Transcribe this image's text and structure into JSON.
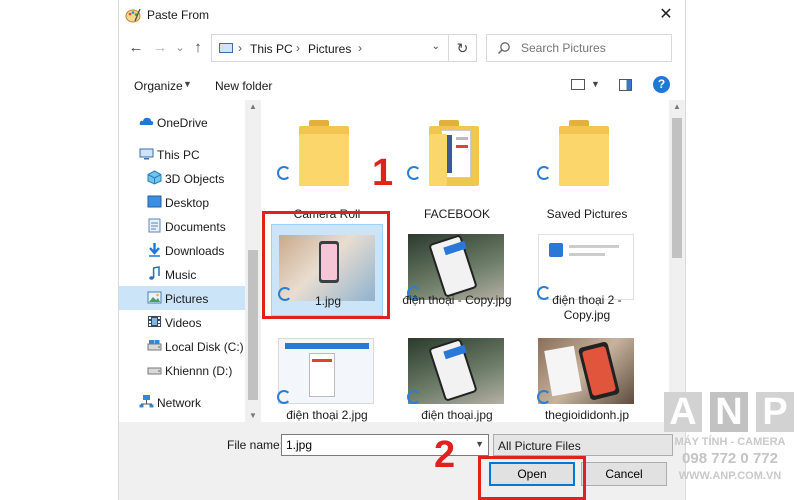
{
  "window": {
    "title": "Paste From",
    "close_glyph": "✕"
  },
  "nav": {
    "back_glyph": "←",
    "forward_glyph": "→",
    "dropdown_glyph": "⌄",
    "up_glyph": "↑",
    "breadcrumb": [
      "This PC",
      "Pictures"
    ],
    "crumb_sep": "›",
    "address_dd_glyph": "⌄",
    "refresh_glyph": "↻",
    "search_placeholder": "Search Pictures"
  },
  "toolbar": {
    "organize_label": "Organize",
    "organize_dd": "▼",
    "new_folder_label": "New folder",
    "view_dd": "▼",
    "help_glyph": "?"
  },
  "sidebar": {
    "items": [
      {
        "label": "OneDrive",
        "icon": "onedrive-icon"
      },
      {
        "label": "This PC",
        "icon": "this-pc-icon"
      },
      {
        "label": "3D Objects",
        "icon": "3d-objects-icon"
      },
      {
        "label": "Desktop",
        "icon": "desktop-icon"
      },
      {
        "label": "Documents",
        "icon": "documents-icon"
      },
      {
        "label": "Downloads",
        "icon": "downloads-icon"
      },
      {
        "label": "Music",
        "icon": "music-icon"
      },
      {
        "label": "Pictures",
        "icon": "pictures-icon"
      },
      {
        "label": "Videos",
        "icon": "videos-icon"
      },
      {
        "label": "Local Disk (C:)",
        "icon": "local-disk-icon"
      },
      {
        "label": "Khiennn (D:)",
        "icon": "drive-icon"
      },
      {
        "label": "Network",
        "icon": "network-icon"
      }
    ],
    "selected": "Pictures"
  },
  "files": [
    {
      "name": "Camera Roll",
      "kind": "folder"
    },
    {
      "name": "FACEBOOK",
      "kind": "folder"
    },
    {
      "name": "Saved Pictures",
      "kind": "folder"
    },
    {
      "name": "1.jpg",
      "kind": "image",
      "selected": true
    },
    {
      "name": "điện thoại - Copy.jpg",
      "kind": "image"
    },
    {
      "name": "điện thoại 2 - Copy.jpg",
      "kind": "image"
    },
    {
      "name": "điện thoại 2.jpg",
      "kind": "image"
    },
    {
      "name": "điện thoại.jpg",
      "kind": "image"
    },
    {
      "name": "thegioididonh.jp",
      "kind": "image"
    }
  ],
  "scroll": {
    "up_glyph": "▲",
    "down_glyph": "▼"
  },
  "footer": {
    "file_name_label": "File name:",
    "file_name_value": "1.jpg",
    "file_name_dd": "▼",
    "file_type_value": "All Picture Files",
    "open_label": "Open",
    "cancel_label": "Cancel"
  },
  "annotations": {
    "step1": "1",
    "step2": "2",
    "color": "#e0221f"
  },
  "watermark": {
    "letters": [
      "A",
      "N",
      "P"
    ],
    "line1": "MÁY TÍNH - CAMERA",
    "line2": "098 772 0 772",
    "line3": "WWW.ANP.COM.VN",
    "color": "#c9c9c9"
  },
  "colors": {
    "selection": "#cce4f7",
    "accent": "#0078d7",
    "folder": "#f1c54f"
  }
}
